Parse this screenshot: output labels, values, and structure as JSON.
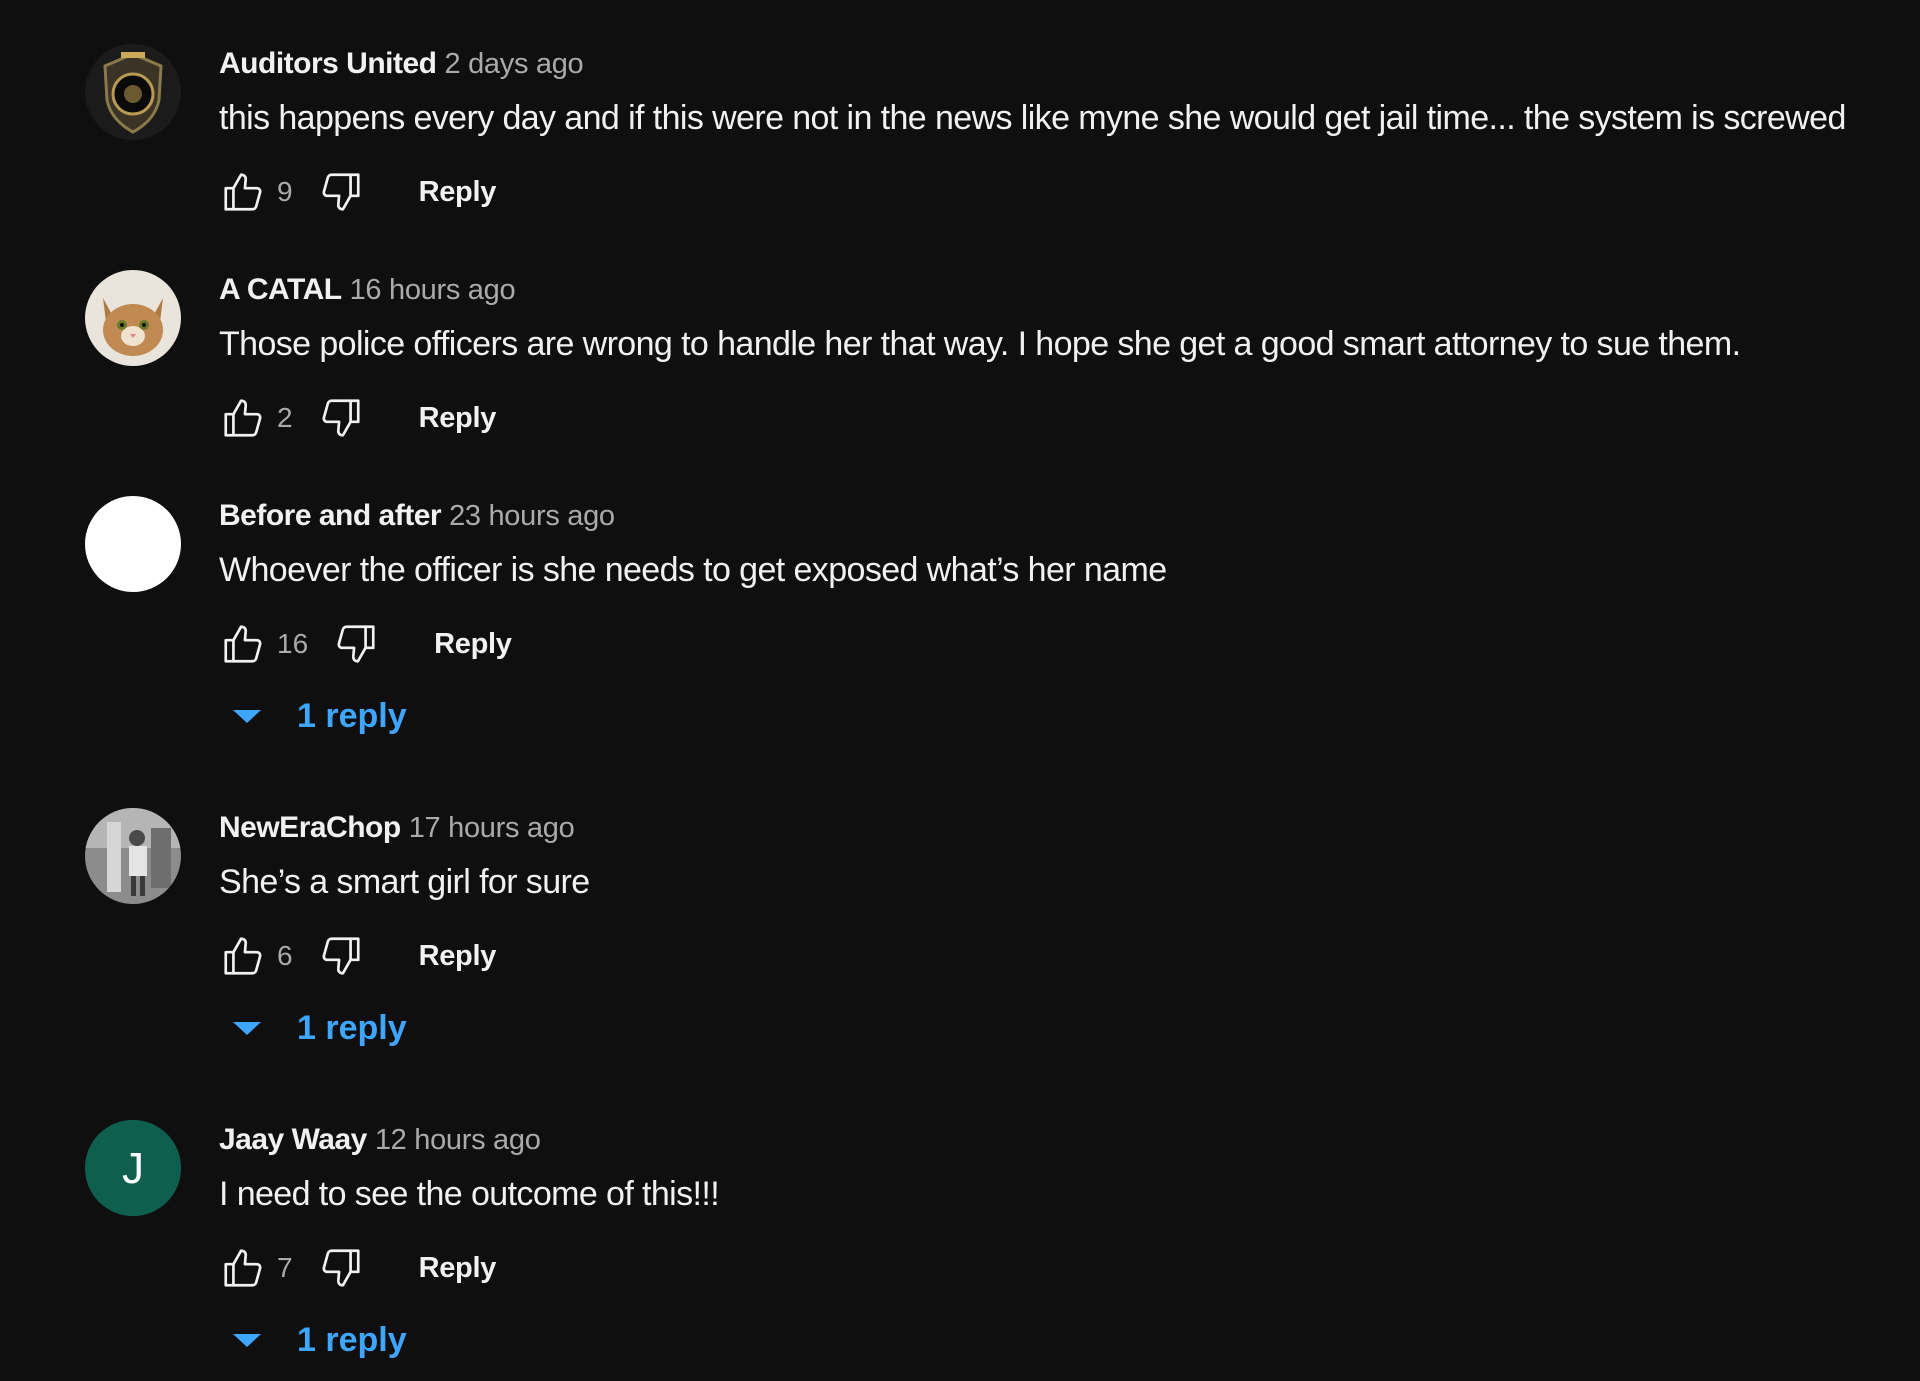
{
  "colors": {
    "background": "#0f0f0f",
    "text_primary": "#f1f1f1",
    "text_secondary": "#aaaaaa",
    "link_blue": "#3ea6ff",
    "avatar_teal": "#0f5f4f"
  },
  "icons": {
    "like": "thumbs-up-icon",
    "dislike": "thumbs-down-icon",
    "expand": "caret-down-icon"
  },
  "comments": [
    {
      "author": "Auditors United",
      "time": "2 days ago",
      "text": "this happens every day and if this were not in the news like myne she would get jail time... the system is screwed",
      "likes": "9",
      "reply_label": "Reply",
      "avatar": "badge-avatar"
    },
    {
      "author": "A CATAL",
      "time": "16 hours ago",
      "text": "Those police officers are wrong to handle her that way. I hope she get a good smart attorney to sue them.",
      "likes": "2",
      "reply_label": "Reply",
      "avatar": "cat-avatar"
    },
    {
      "author": "Before and after",
      "time": "23 hours ago",
      "text": "Whoever the officer is she needs to get exposed what’s her name",
      "likes": "16",
      "reply_label": "Reply",
      "replies_label": "1 reply",
      "avatar": "white-avatar"
    },
    {
      "author": "NewEraChop",
      "time": "17 hours ago",
      "text": "She’s a smart girl for sure",
      "likes": "6",
      "reply_label": "Reply",
      "replies_label": "1 reply",
      "avatar": "photo-avatar"
    },
    {
      "author": "Jaay Waay",
      "time": "12 hours ago",
      "text": "I need to see the outcome of this!!!",
      "likes": "7",
      "reply_label": "Reply",
      "replies_label": "1 reply",
      "avatar": "letter-avatar",
      "avatar_letter": "J"
    }
  ]
}
